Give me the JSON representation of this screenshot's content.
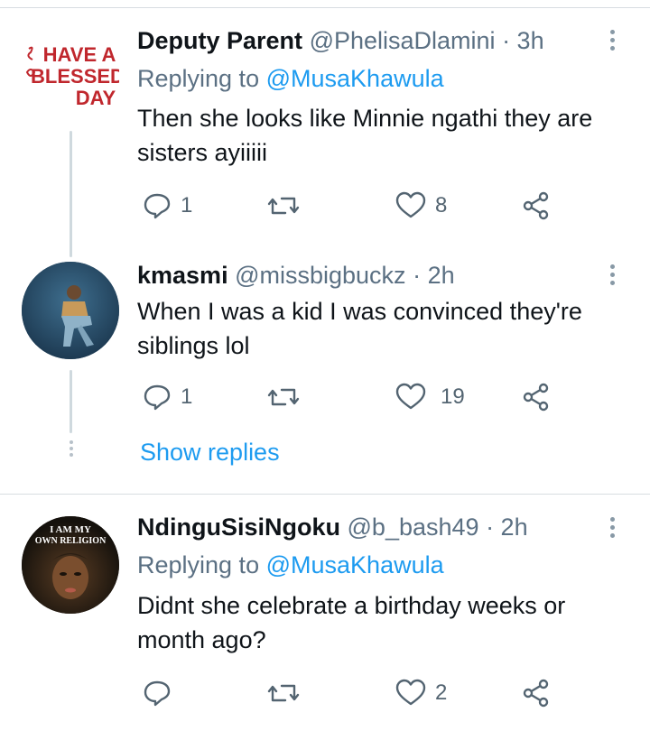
{
  "tweets": [
    {
      "name": "Deputy Parent",
      "handle": "@PhelisaDlamini",
      "time": "· 3h",
      "replying_label": "Replying to",
      "replying_to": "@MusaKhawula",
      "text": "Then she looks like Minnie ngathi they are sisters ayiiiii",
      "avatar_text": [
        "HAVE A",
        "BLESSED",
        "DAY"
      ],
      "replies": "1",
      "retweets": "",
      "likes": "8"
    },
    {
      "name": "kmasmi",
      "handle": "@missbigbuckz",
      "time": "· 2h",
      "text": "When I was a kid I was convinced they're siblings lol",
      "replies": "1",
      "retweets": "",
      "likes": "19"
    },
    {
      "name": "NdinguSisiNgoku",
      "handle": "@b_bash49",
      "time": "· 2h",
      "replying_label": "Replying to",
      "replying_to": "@MusaKhawula",
      "text": "Didnt she celebrate a birthday weeks or month ago?",
      "avatar_text": [
        "I AM MY",
        "OWN RELIGION"
      ],
      "replies": "",
      "retweets": "",
      "likes": "2"
    }
  ],
  "show_replies": "Show replies",
  "colors": {
    "accent": "#1d9bf0",
    "secondary": "#5b7083",
    "icon": "#536471",
    "avatar_text_red": "#c0272d"
  }
}
